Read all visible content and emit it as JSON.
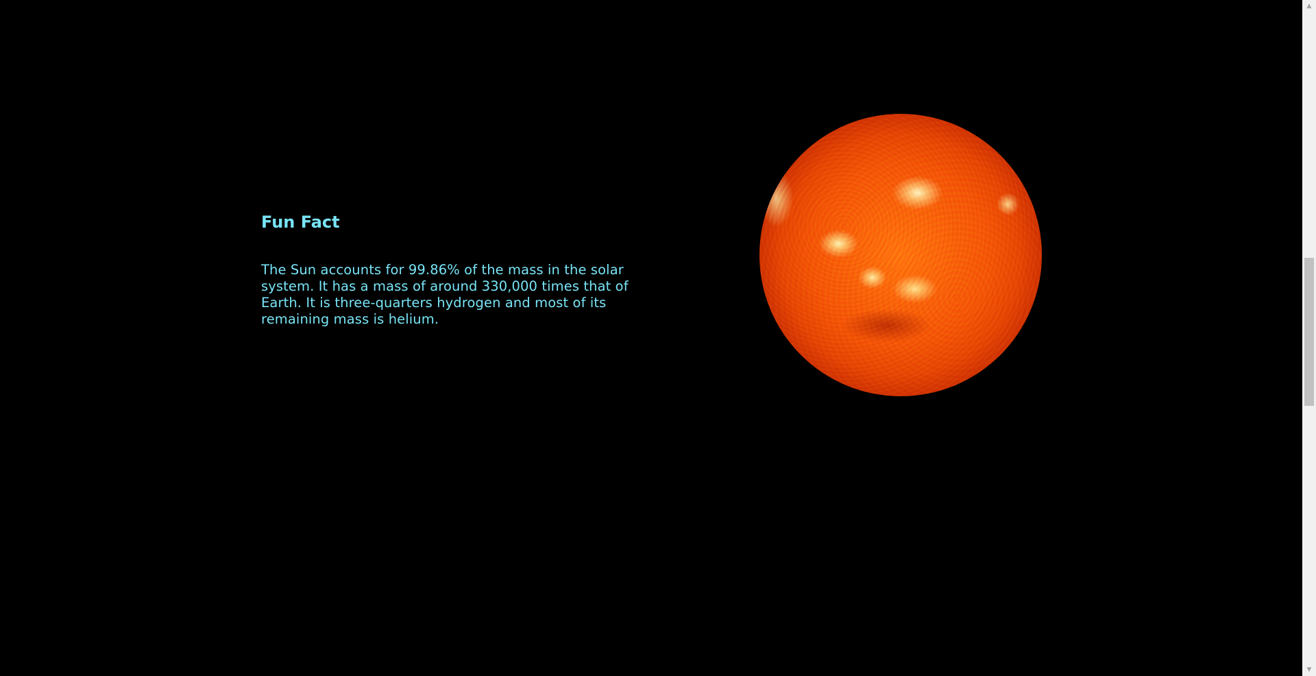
{
  "page": {
    "background_color": "#000000",
    "text_color": "#78e4f6"
  },
  "fact": {
    "title": "Fun Fact",
    "text": "The Sun accounts for 99.86% of the mass in the solar system. It has a mass of around 330,000 times that of Earth. It is three-quarters hydrogen and most of its remaining mass is helium."
  },
  "sun_image": {
    "icon": "sun-image"
  },
  "scrollbar": {
    "up_icon": "chevron-up-icon",
    "down_icon": "chevron-down-icon",
    "up_glyph": "▲",
    "down_glyph": "▼"
  }
}
